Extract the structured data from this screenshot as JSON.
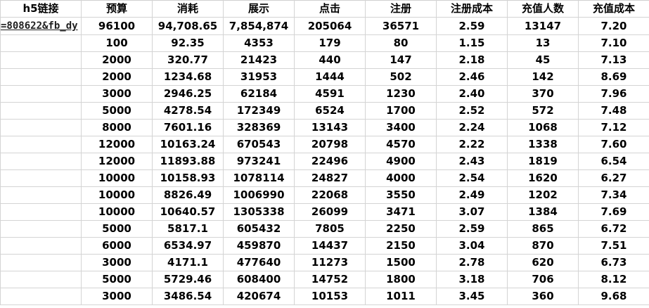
{
  "sheet": {
    "headers": [
      "h5链接",
      "预算",
      "消耗",
      "展示",
      "点击",
      "注册",
      "注册成本",
      "充值人数",
      "充值成本"
    ],
    "rows": [
      [
        "=808622&fb_dy",
        "96100",
        "94,708.65",
        "7,854,874",
        "205064",
        "36571",
        "2.59",
        "13147",
        "7.20"
      ],
      [
        "",
        "100",
        "92.35",
        "4353",
        "179",
        "80",
        "1.15",
        "13",
        "7.10"
      ],
      [
        "",
        "2000",
        "320.77",
        "21423",
        "440",
        "147",
        "2.18",
        "45",
        "7.13"
      ],
      [
        "",
        "2000",
        "1234.68",
        "31953",
        "1444",
        "502",
        "2.46",
        "142",
        "8.69"
      ],
      [
        "",
        "3000",
        "2946.25",
        "62184",
        "4591",
        "1230",
        "2.40",
        "370",
        "7.96"
      ],
      [
        "",
        "5000",
        "4278.54",
        "172349",
        "6524",
        "1700",
        "2.52",
        "572",
        "7.48"
      ],
      [
        "",
        "8000",
        "7601.16",
        "328369",
        "13143",
        "3400",
        "2.24",
        "1068",
        "7.12"
      ],
      [
        "",
        "12000",
        "10163.24",
        "670543",
        "20798",
        "4570",
        "2.22",
        "1338",
        "7.60"
      ],
      [
        "",
        "12000",
        "11893.88",
        "973241",
        "22496",
        "4900",
        "2.43",
        "1819",
        "6.54"
      ],
      [
        "",
        "10000",
        "10158.93",
        "1078114",
        "24827",
        "4000",
        "2.54",
        "1620",
        "6.27"
      ],
      [
        "",
        "10000",
        "8826.49",
        "1006990",
        "22068",
        "3550",
        "2.49",
        "1202",
        "7.34"
      ],
      [
        "",
        "10000",
        "10640.57",
        "1305338",
        "26099",
        "3471",
        "3.07",
        "1384",
        "7.69"
      ],
      [
        "",
        "5000",
        "5817.1",
        "605432",
        "7805",
        "2250",
        "2.59",
        "865",
        "6.72"
      ],
      [
        "",
        "6000",
        "6534.97",
        "459870",
        "14437",
        "2150",
        "3.04",
        "870",
        "7.51"
      ],
      [
        "",
        "3000",
        "4171.1",
        "477640",
        "11273",
        "1500",
        "2.78",
        "620",
        "6.73"
      ],
      [
        "",
        "5000",
        "5729.46",
        "608400",
        "14752",
        "1800",
        "3.18",
        "706",
        "8.12"
      ],
      [
        "",
        "3000",
        "3486.54",
        "420674",
        "10153",
        "1011",
        "3.45",
        "360",
        "9.68"
      ]
    ]
  },
  "colors": {
    "gridline": "#d4d4d4",
    "text": "#000000",
    "background": "#ffffff"
  }
}
